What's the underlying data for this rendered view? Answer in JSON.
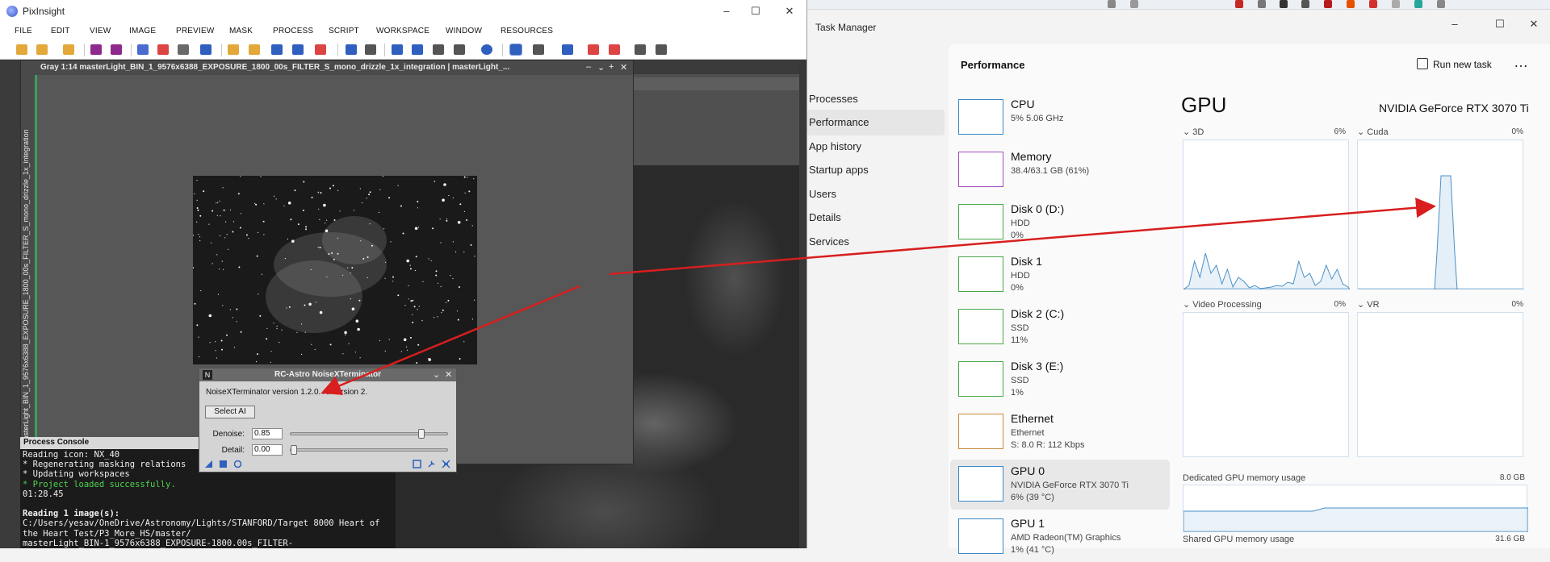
{
  "pixinsight": {
    "title": "PixInsight",
    "menu": [
      "FILE",
      "EDIT",
      "VIEW",
      "IMAGE",
      "PREVIEW",
      "MASK",
      "PROCESS",
      "SCRIPT",
      "WORKSPACE",
      "WINDOW",
      "RESOURCES"
    ],
    "image_window": {
      "title": "Gray 1:14 masterLight_BIN_1_9576x6388_EXPOSURE_1800_00s_FILTER_S_mono_drizzle_1x_integration | masterLight_...",
      "side_label": "masterLight_BIN_1_9576x6388_EXPOSURE_1800_00s_FILTER_S_mono_drizzle_1x_integration"
    },
    "process_console": {
      "title": "Process Console",
      "lines": [
        {
          "text": "Reading icon: NX_40",
          "style": "normal"
        },
        {
          "text": "* Regenerating masking relations",
          "style": "normal"
        },
        {
          "text": "* Updating workspaces",
          "style": "normal"
        },
        {
          "text": "* Project loaded successfully.",
          "style": "green"
        },
        {
          "text": "01:28.45",
          "style": "normal"
        },
        {
          "text": "",
          "style": "normal"
        },
        {
          "text": "Reading 1 image(s):",
          "style": "bold"
        },
        {
          "text": "C:/Users/yesav/OneDrive/Astronomy/Lights/STANFORD/Target 8000 Heart of",
          "style": "normal"
        },
        {
          "text": "the Heart Test/P3_More_HS/master/",
          "style": "normal"
        },
        {
          "text": "masterLight_BIN-1_9576x6388_EXPOSURE-1800.00s_FILTER-",
          "style": "normal"
        }
      ]
    },
    "noisexterminator": {
      "title": "RC-Astro NoiseXTerminator",
      "badge": "N",
      "version_text": "NoiseXTerminator version 1.2.0. AI version 2.",
      "select_ai_label": "Select AI",
      "denoise_label": "Denoise:",
      "denoise_value": "0.85",
      "denoise_level": 0.85,
      "detail_label": "Detail:",
      "detail_value": "0.00",
      "detail_level": 0.0
    }
  },
  "task_manager": {
    "title": "Task Manager",
    "nav": [
      "Processes",
      "Performance",
      "App history",
      "Startup apps",
      "Users",
      "Details",
      "Services"
    ],
    "active_nav": "Performance",
    "header": "Performance",
    "run_new_task": "Run new task",
    "more": "…",
    "devices": [
      {
        "name": "CPU",
        "lines": [
          "5% 5.06 GHz"
        ],
        "color": "#3a88c8"
      },
      {
        "name": "Memory",
        "lines": [
          "38.4/63.1 GB (61%)"
        ],
        "color": "#a04fb8"
      },
      {
        "name": "Disk 0 (D:)",
        "lines": [
          "HDD",
          "0%"
        ],
        "color": "#4aa84a"
      },
      {
        "name": "Disk 1",
        "lines": [
          "HDD",
          "0%"
        ],
        "color": "#4aa84a"
      },
      {
        "name": "Disk 2 (C:)",
        "lines": [
          "SSD",
          "11%"
        ],
        "color": "#4aa84a"
      },
      {
        "name": "Disk 3 (E:)",
        "lines": [
          "SSD",
          "1%"
        ],
        "color": "#4aa84a"
      },
      {
        "name": "Ethernet",
        "lines": [
          "Ethernet",
          "S: 8.0 R: 112 Kbps"
        ],
        "color": "#c98a3a"
      },
      {
        "name": "GPU 0",
        "lines": [
          "NVIDIA GeForce RTX 3070 Ti",
          "6% (39 °C)"
        ],
        "color": "#3a88c8"
      },
      {
        "name": "GPU 1",
        "lines": [
          "AMD Radeon(TM) Graphics",
          "1% (41 °C)"
        ],
        "color": "#3a88c8"
      }
    ],
    "gpu": {
      "title": "GPU",
      "model": "NVIDIA GeForce RTX 3070 Ti",
      "engines": [
        {
          "label": "3D",
          "pct": "6%"
        },
        {
          "label": "Cuda",
          "pct": "0%"
        },
        {
          "label": "Video Processing",
          "pct": "0%"
        },
        {
          "label": "VR",
          "pct": "0%"
        }
      ],
      "dedicated_label": "Dedicated GPU memory usage",
      "dedicated_max": "8.0 GB",
      "shared_label": "Shared GPU memory usage",
      "shared_max": "31.6 GB"
    }
  },
  "colors": {
    "annotation_arrow": "#d81e1e",
    "console_green": "#4fd44f",
    "graph_line": "#4a90c8"
  }
}
